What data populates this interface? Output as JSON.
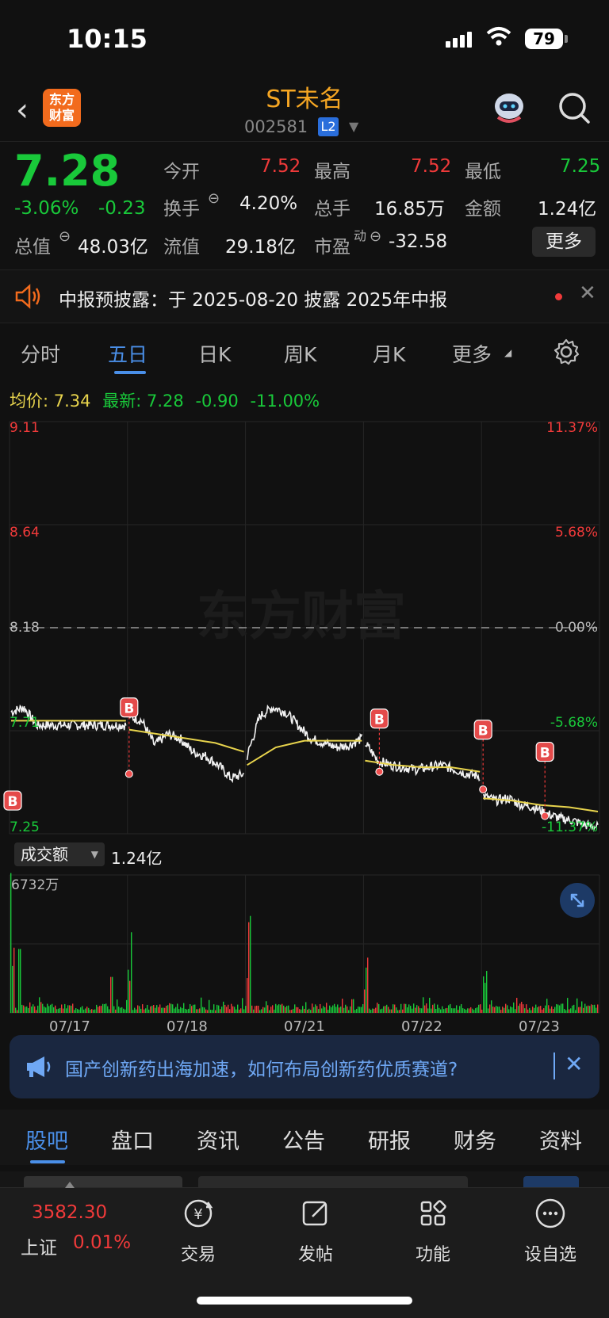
{
  "status": {
    "time": "10:15",
    "battery": "79"
  },
  "header": {
    "title": "ST未名",
    "code": "002581",
    "level": "L2",
    "logo_line1": "东方",
    "logo_line2": "财富"
  },
  "quote": {
    "price": "7.28",
    "pct": "-3.06%",
    "change": "-0.23",
    "open_label": "今开",
    "open": "7.52",
    "high_label": "最高",
    "high": "7.52",
    "low_label": "最低",
    "low": "7.25",
    "turnover_label": "换手",
    "turnover": "4.20%",
    "volume_label": "总手",
    "volume": "16.85万",
    "amount_label": "金额",
    "amount": "1.24亿",
    "mcap_label": "总值",
    "mcap": "48.03亿",
    "float_label": "流值",
    "float": "29.18亿",
    "pe_label": "市盈",
    "pe_sup": "动",
    "pe": "-32.58",
    "more": "更多"
  },
  "notice": {
    "text": "中报预披露：于 2025-08-20 披露 2025年中报"
  },
  "tabs": [
    {
      "label": "分时"
    },
    {
      "label": "五日"
    },
    {
      "label": "日K"
    },
    {
      "label": "周K"
    },
    {
      "label": "月K"
    },
    {
      "label": "更多"
    }
  ],
  "chart_info": {
    "avg_label": "均价:",
    "avg": "7.34",
    "latest_label": "最新:",
    "latest": "7.28",
    "chg": "-0.90",
    "pct": "-11.00%"
  },
  "chart_data": {
    "type": "line",
    "title": "",
    "x": [
      "07/17",
      "07/18",
      "07/21",
      "07/22",
      "07/23"
    ],
    "y_ticks": [
      "9.11",
      "8.64",
      "8.18",
      "7.71",
      "7.25"
    ],
    "pct_ticks": [
      "11.37%",
      "5.68%",
      "0.00%",
      "-5.68%",
      "-11.37%"
    ],
    "ylim": [
      7.25,
      9.11
    ],
    "reference_price": 8.18,
    "series": [],
    "day_close_approx": [
      7.88,
      7.75,
      7.73,
      7.55,
      7.28
    ],
    "buy_markers": [
      "B",
      "B",
      "B",
      "B",
      "B"
    ],
    "volume": {
      "label": "成交额",
      "total": "1.24亿",
      "max": "6732万"
    }
  },
  "news": {
    "text": "国产创新药出海加速，如何布局创新药优质赛道?"
  },
  "bottom_tabs": [
    {
      "label": "股吧"
    },
    {
      "label": "盘口"
    },
    {
      "label": "资讯"
    },
    {
      "label": "公告"
    },
    {
      "label": "研报"
    },
    {
      "label": "财务"
    },
    {
      "label": "资料"
    }
  ],
  "footer": {
    "index_value": "3582.30",
    "index_name": "上证",
    "index_pct": "0.01%",
    "buttons": [
      {
        "label": "交易"
      },
      {
        "label": "发帖"
      },
      {
        "label": "功能"
      },
      {
        "label": "设自选"
      }
    ]
  },
  "colors": {
    "up": "#f03a3a",
    "down": "#19c93a",
    "accent": "#4a8fe8",
    "avg_line": "#e8d44d"
  }
}
